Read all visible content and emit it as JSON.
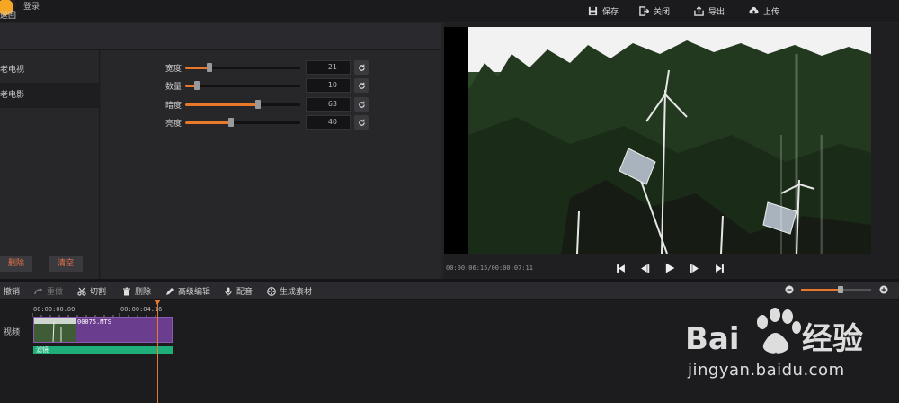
{
  "header": {
    "login_label": "登录",
    "save_label": "保存",
    "close_label": "关闭",
    "export_label": "导出",
    "upload_label": "上传"
  },
  "left_panel": {
    "back_label": "返回",
    "categories": [
      {
        "label": "老电视",
        "active": false
      },
      {
        "label": "老电影",
        "active": true
      }
    ],
    "delete_label": "删除",
    "clear_label": "清空"
  },
  "params": [
    {
      "label": "宽度",
      "value": "21",
      "level": 21
    },
    {
      "label": "数量",
      "value": "10",
      "level": 10
    },
    {
      "label": "暗度",
      "value": "63",
      "level": 63
    },
    {
      "label": "亮度",
      "value": "40",
      "level": 40
    }
  ],
  "preview": {
    "timecode": "00:00:06:15/00:00:07:11"
  },
  "toolbar": {
    "undo_label": "撤销",
    "redo_label": "重做",
    "cut_label": "切割",
    "delete_label": "删除",
    "advanced_label": "高级编辑",
    "dub_label": "配音",
    "generate_label": "生成素材",
    "zoom_level": 0.56
  },
  "timeline": {
    "ruler_start": "00:00:00.00",
    "ruler_mid": "00:00:04.16",
    "track_label": "视频",
    "clip_name": "00075.MTS",
    "filter_label": "滤镜"
  },
  "watermark": {
    "text": "jingyan.baidu.com"
  },
  "colors": {
    "accent": "#e8792a",
    "clip": "#6a3d8f",
    "filter": "#1fae7a"
  }
}
